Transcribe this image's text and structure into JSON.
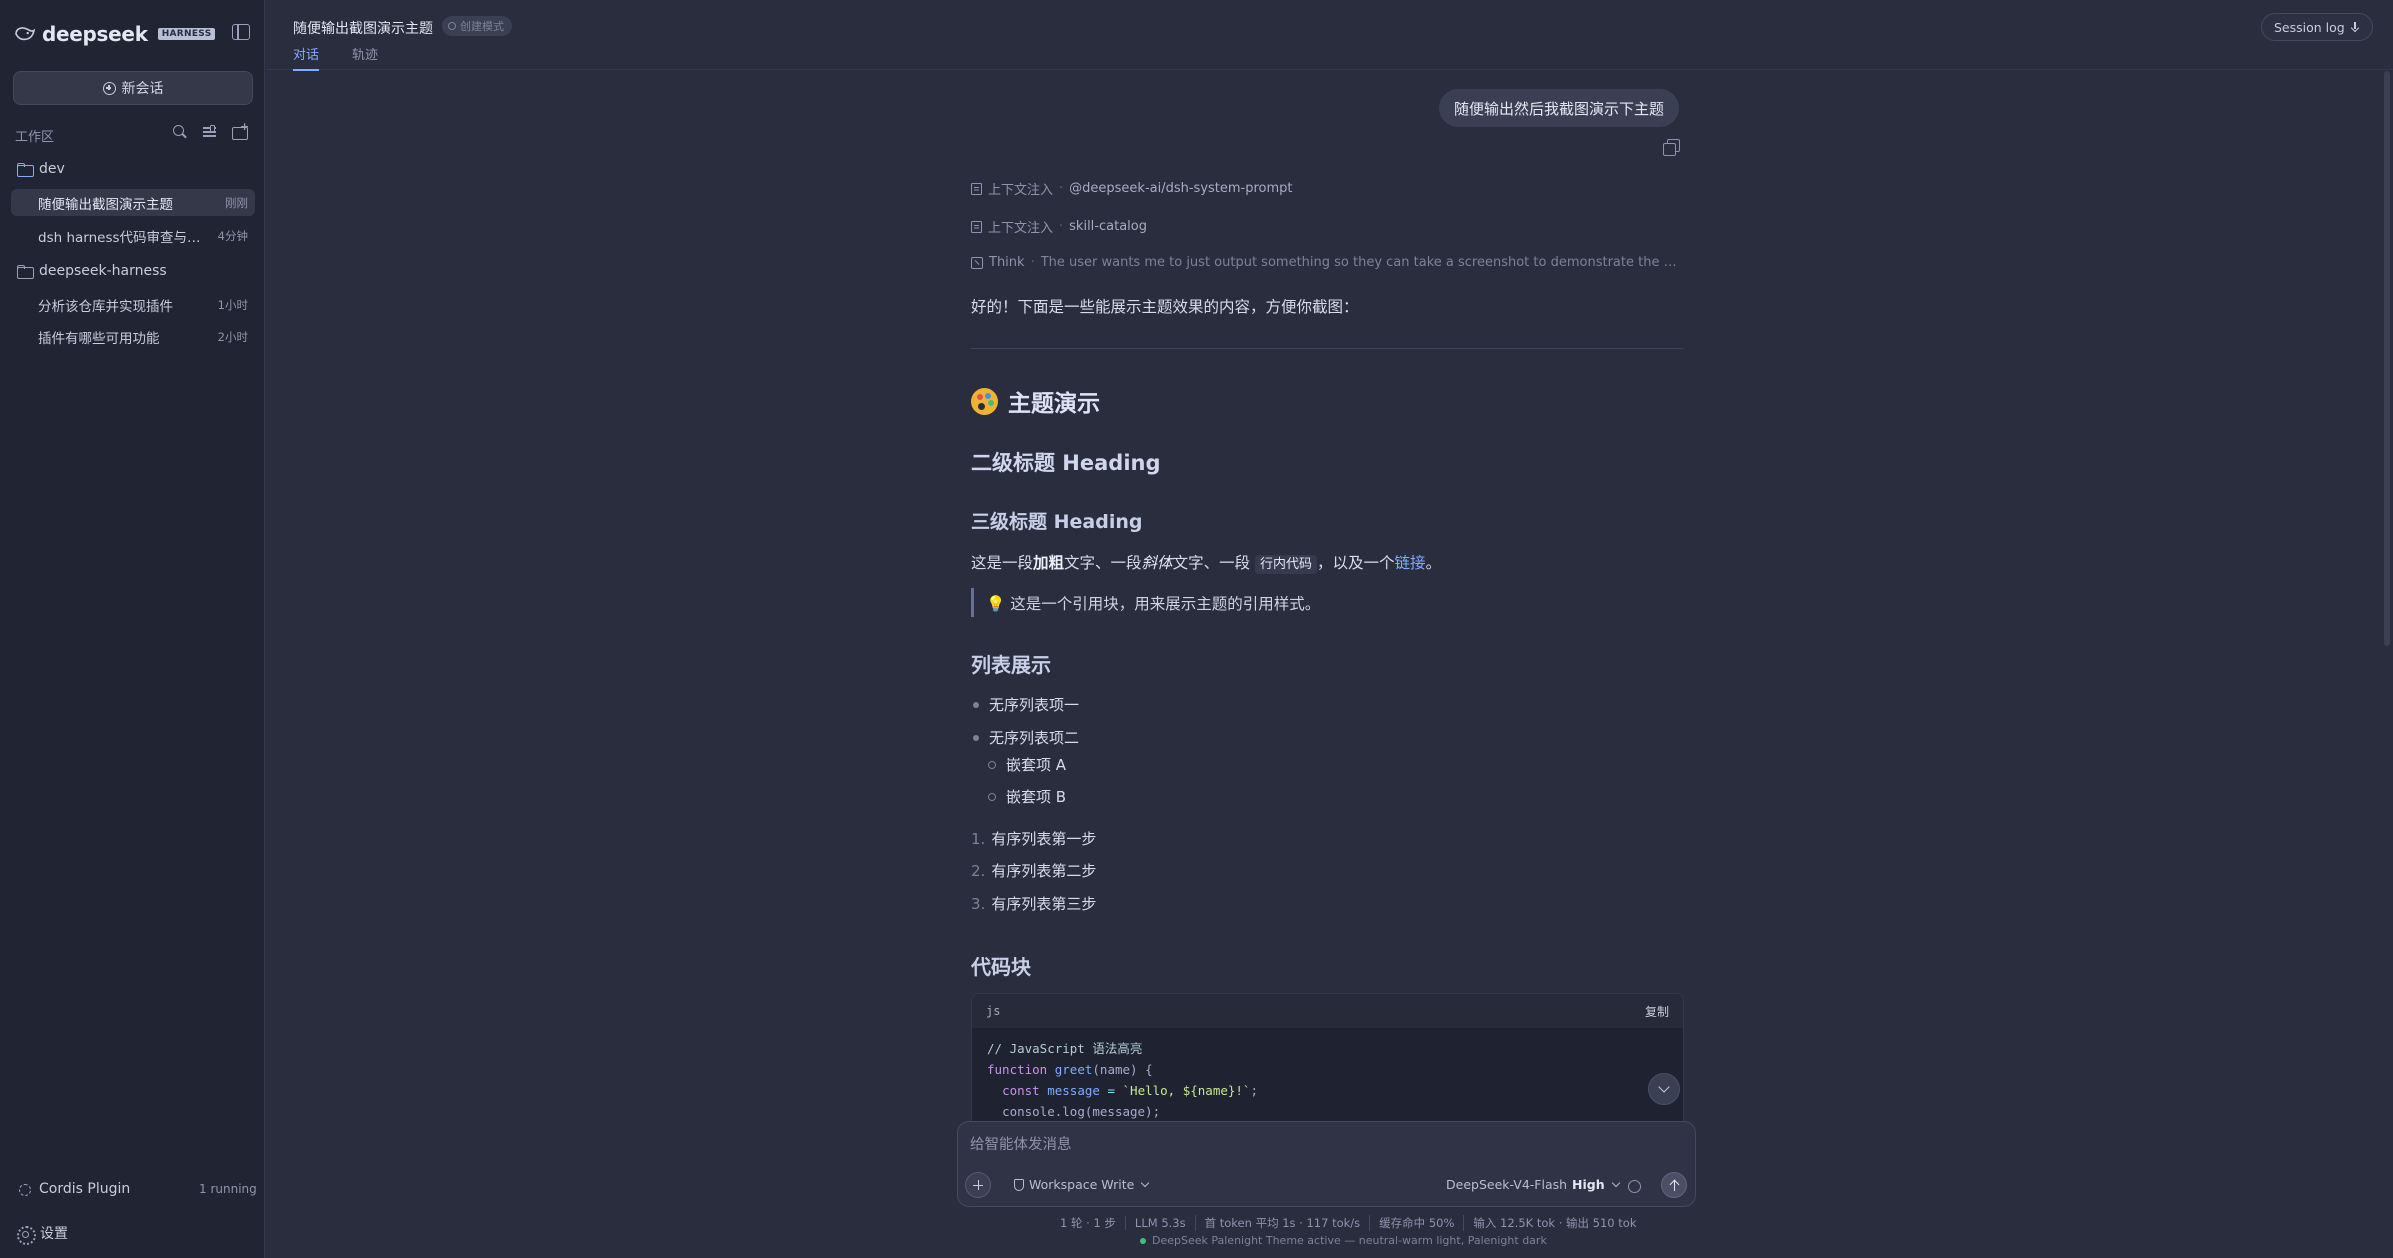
{
  "sidebar": {
    "brand": "deepseek",
    "badge": "HARNESS",
    "new_chat_label": "新会话",
    "workspace_label": "工作区",
    "folders": [
      {
        "name": "dev",
        "items": [
          {
            "title": "随便输出截图演示主题",
            "time": "刚刚",
            "active": true
          },
          {
            "title": "dsh harness代码审查与Web...",
            "time": "4分钟",
            "active": false
          }
        ]
      },
      {
        "name": "deepseek-harness",
        "items": [
          {
            "title": "分析该仓库并实现插件",
            "time": "1小时",
            "active": false
          },
          {
            "title": "插件有哪些可用功能",
            "time": "2小时",
            "active": false
          }
        ]
      }
    ],
    "plugin_label": "Cordis Plugin",
    "plugin_status": "1 running",
    "settings_label": "设置"
  },
  "header": {
    "title": "随便输出截图演示主题",
    "badge": "创建模式",
    "tabs": [
      "对话",
      "轨迹"
    ],
    "active_tab": 0,
    "session_log": "Session log"
  },
  "chat": {
    "user_message": "随便输出然后我截图演示下主题",
    "trace": [
      {
        "kind": "上下文注入",
        "value": "@deepseek-ai/dsh-system-prompt"
      },
      {
        "kind": "上下文注入",
        "value": "skill-catalog"
      },
      {
        "kind": "Think",
        "value": "The user wants me to just output something so they can take a screenshot to demonstrate the theme. This i..."
      }
    ],
    "intro": "好的！下面是一些能展示主题效果的内容，方便你截图：",
    "h1": "主题演示",
    "h2": "二级标题 Heading",
    "h3": "三级标题 Heading",
    "para": {
      "p1": "这是一段",
      "bold": "加粗",
      "p2": "文字、一段",
      "italic": "斜体",
      "p3": "文字、一段",
      "code": "行内代码",
      "p4": "，以及一个",
      "link": "链接",
      "p5": "。"
    },
    "quote": "💡 这是一个引用块，用来展示主题的引用样式。",
    "list_heading": "列表展示",
    "bullets": [
      "无序列表项一",
      "无序列表项二"
    ],
    "sub_bullets": [
      "嵌套项 A",
      "嵌套项 B"
    ],
    "ordered": [
      {
        "num": "1.",
        "text": "有序列表第一步"
      },
      {
        "num": "2.",
        "text": "有序列表第二步"
      },
      {
        "num": "3.",
        "text": "有序列表第三步"
      }
    ],
    "code_heading": "代码块",
    "code": {
      "lang": "js",
      "copy_label": "复制",
      "comment": "// JavaScript 语法高亮",
      "l2_kw": "function",
      "l2_fn": "greet",
      "l2_rest": "(name) {",
      "l3_kw": "const",
      "l3_var": "message",
      "l3_op": "=",
      "l3_str": "`Hello, ${name}!`",
      "l3_end": ";",
      "l4": "console.log(message);"
    }
  },
  "composer": {
    "placeholder": "给智能体发消息",
    "workspace_mode": "Workspace Write",
    "model": "DeepSeek-V4-Flash",
    "effort": "High"
  },
  "status": {
    "turns": "1 轮 · 1 步",
    "llm": "LLM 5.3s",
    "token": "首 token 平均 1s · 117 tok/s",
    "cache": "缓存命中 50%",
    "io": "输入 12.5K tok · 输出 510 tok",
    "theme": "DeepSeek Palenight Theme active — neutral-warm light, Palenight dark"
  },
  "colors": {
    "accent": "#82aaff",
    "background": "#292d3e",
    "sidebar": "#212433",
    "status_dot": "#3fbf7f"
  }
}
